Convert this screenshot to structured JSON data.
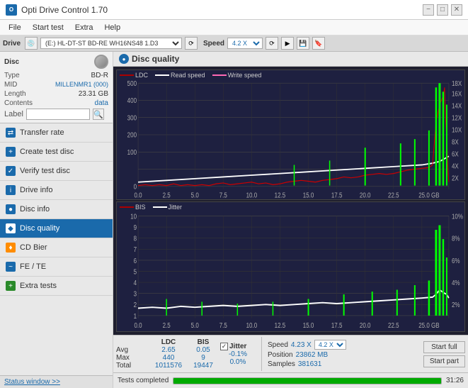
{
  "titlebar": {
    "title": "Opti Drive Control 1.70",
    "icon_text": "O",
    "minimize": "−",
    "maximize": "□",
    "close": "✕"
  },
  "menubar": {
    "items": [
      "File",
      "Start test",
      "Extra",
      "Help"
    ]
  },
  "drive": {
    "label": "Drive",
    "selected": "(E:)  HL-DT-ST BD-RE  WH16NS48 1.D3",
    "speed_label": "Speed",
    "speed_selected": "4.2 X"
  },
  "disc": {
    "title": "Disc",
    "type_label": "Type",
    "type_value": "BD-R",
    "mid_label": "MID",
    "mid_value": "MILLENMR1 (000)",
    "length_label": "Length",
    "length_value": "23.31 GB",
    "contents_label": "Contents",
    "contents_value": "data",
    "label_label": "Label",
    "label_placeholder": ""
  },
  "nav_items": [
    {
      "id": "transfer-rate",
      "label": "Transfer rate",
      "icon": "⇄",
      "color": "blue",
      "active": false
    },
    {
      "id": "create-test-disc",
      "label": "Create test disc",
      "icon": "+",
      "color": "blue",
      "active": false
    },
    {
      "id": "verify-test-disc",
      "label": "Verify test disc",
      "icon": "✓",
      "color": "blue",
      "active": false
    },
    {
      "id": "drive-info",
      "label": "Drive info",
      "icon": "i",
      "color": "blue",
      "active": false
    },
    {
      "id": "disc-info",
      "label": "Disc info",
      "icon": "●",
      "color": "blue",
      "active": false
    },
    {
      "id": "disc-quality",
      "label": "Disc quality",
      "icon": "◆",
      "color": "blue",
      "active": true
    },
    {
      "id": "cd-bier",
      "label": "CD Bier",
      "icon": "♦",
      "color": "orange",
      "active": false
    },
    {
      "id": "fe-te",
      "label": "FE / TE",
      "icon": "~",
      "color": "blue",
      "active": false
    },
    {
      "id": "extra-tests",
      "label": "Extra tests",
      "icon": "+",
      "color": "green",
      "active": false
    }
  ],
  "content": {
    "title": "Disc quality",
    "chart1": {
      "legend": [
        {
          "label": "LDC",
          "color": "#aa0000"
        },
        {
          "label": "Read speed",
          "color": "#ffffff"
        },
        {
          "label": "Write speed",
          "color": "#ff69b4"
        }
      ],
      "y_left": [
        "500",
        "400",
        "300",
        "200",
        "100",
        "0"
      ],
      "y_right": [
        "18X",
        "16X",
        "14X",
        "12X",
        "10X",
        "8X",
        "6X",
        "4X",
        "2X"
      ],
      "x_labels": [
        "0.0",
        "2.5",
        "5.0",
        "7.5",
        "10.0",
        "12.5",
        "15.0",
        "17.5",
        "20.0",
        "22.5",
        "25.0 GB"
      ]
    },
    "chart2": {
      "legend": [
        {
          "label": "BIS",
          "color": "#aa0000"
        },
        {
          "label": "Jitter",
          "color": "#ffffff"
        }
      ],
      "y_left": [
        "10",
        "9",
        "8",
        "7",
        "6",
        "5",
        "4",
        "3",
        "2",
        "1"
      ],
      "y_right": [
        "10%",
        "8%",
        "6%",
        "4%",
        "2%"
      ],
      "x_labels": [
        "0.0",
        "2.5",
        "5.0",
        "7.5",
        "10.0",
        "12.5",
        "15.0",
        "17.5",
        "20.0",
        "22.5",
        "25.0 GB"
      ]
    }
  },
  "stats": {
    "ldc_label": "LDC",
    "bis_label": "BIS",
    "jitter_label": "Jitter",
    "jitter_checked": true,
    "avg_label": "Avg",
    "max_label": "Max",
    "total_label": "Total",
    "ldc_avg": "2.65",
    "ldc_max": "440",
    "ldc_total": "1011576",
    "bis_avg": "0.05",
    "bis_max": "9",
    "bis_total": "19447",
    "jitter_avg": "-0.1%",
    "jitter_max": "0.0%",
    "jitter_total": "",
    "speed_label": "Speed",
    "speed_value": "4.23 X",
    "speed_dropdown": "4.2 X",
    "position_label": "Position",
    "position_value": "23862 MB",
    "samples_label": "Samples",
    "samples_value": "381631",
    "start_full": "Start full",
    "start_part": "Start part"
  },
  "statusbar": {
    "status_btn": "Status window >>",
    "progress_pct": 100,
    "status_text": "Tests completed",
    "time": "31:26"
  }
}
